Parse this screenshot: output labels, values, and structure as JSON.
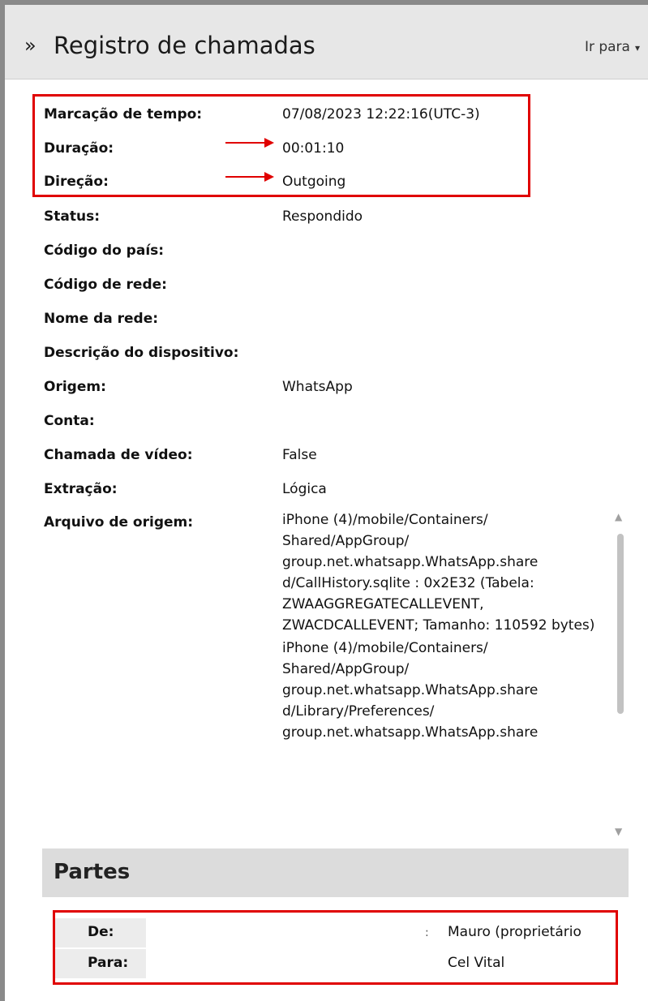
{
  "header": {
    "chevron_glyph": "»",
    "title": "Registro de chamadas",
    "goto_label": "Ir para",
    "goto_caret": "▾"
  },
  "fields": [
    {
      "label": "Marcação de tempo:",
      "value": "07/08/2023 12:22:16(UTC-3)"
    },
    {
      "label": "Duração:",
      "value": "00:01:10"
    },
    {
      "label": "Direção:",
      "value": "Outgoing"
    },
    {
      "label": "Status:",
      "value": "Respondido"
    },
    {
      "label": "Código do país:",
      "value": ""
    },
    {
      "label": "Código de rede:",
      "value": ""
    },
    {
      "label": "Nome da rede:",
      "value": ""
    },
    {
      "label": "Descrição do dispositivo:",
      "value": ""
    },
    {
      "label": "Origem:",
      "value": "WhatsApp"
    },
    {
      "label": "Conta:",
      "value": ""
    },
    {
      "label": "Chamada de vídeo:",
      "value": "False"
    },
    {
      "label": "Extração:",
      "value": "Lógica"
    },
    {
      "label": "Arquivo de origem:",
      "value": ""
    }
  ],
  "source_files": [
    "iPhone (4)/mobile/Containers/ Shared/AppGroup/ group.net.whatsapp.WhatsApp.share d/CallHistory.sqlite : 0x2E32 (Tabela: ZWAAGGREGATECALLEVENT, ZWACDCALLEVENT; Tamanho: 110592 bytes)",
    "iPhone (4)/mobile/Containers/ Shared/AppGroup/ group.net.whatsapp.WhatsApp.share d/Library/Preferences/ group.net.whatsapp.WhatsApp.share"
  ],
  "partes": {
    "title": "Partes",
    "rows": [
      {
        "label": "De:",
        "value": "Mauro (proprietário"
      },
      {
        "label": "Para:",
        "value": "Cel Vital"
      }
    ]
  },
  "scrollbar": {
    "up_glyph": "▲",
    "down_glyph": "▼"
  },
  "colors": {
    "highlight": "#e00000",
    "header_bg": "#e7e7e7",
    "section_bg": "#dcdcdc"
  }
}
